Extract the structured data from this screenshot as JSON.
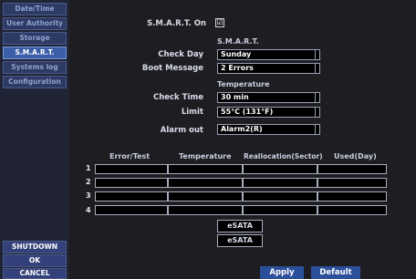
{
  "sidebar": {
    "items": [
      {
        "label": "Date/Time"
      },
      {
        "label": "User Authority"
      },
      {
        "label": "Storage"
      },
      {
        "label": "S.M.A.R.T."
      },
      {
        "label": "Systems log"
      },
      {
        "label": "Configuration"
      }
    ],
    "shutdown_label": "SHUTDOWN",
    "ok_label": "OK",
    "cancel_label": "CANCEL"
  },
  "smart": {
    "smart_on_label": "S.M.A.R.T. On",
    "smart_on_checked": true,
    "checkbox_glyph": "☑",
    "section_title": "S.M.A.R.T.",
    "check_day_label": "Check Day",
    "check_day_value": "Sunday",
    "boot_message_label": "Boot Message",
    "boot_message_value": "2 Errors"
  },
  "temperature": {
    "section_title": "Temperature",
    "check_time_label": "Check Time",
    "check_time_value": "30 min",
    "limit_label": "Limit",
    "limit_value": "55°C (131°F)",
    "alarm_out_label": "Alarm out",
    "alarm_out_value": "Alarm2(R)"
  },
  "table": {
    "headers": [
      "Error/Test",
      "Temperature",
      "Reallocation(Sector)",
      "Used(Day)"
    ],
    "row_numbers": [
      "1",
      "2",
      "3",
      "4"
    ]
  },
  "esata": {
    "button1_label": "eSATA",
    "button2_label": "eSATA"
  },
  "actions": {
    "apply_label": "Apply",
    "default_label": "Default"
  },
  "colors": {
    "sidebar_bg": "#202434",
    "main_bg": "#1e1e22",
    "active_tab": "#3a5ea8",
    "action_button": "#2b4f9a"
  }
}
